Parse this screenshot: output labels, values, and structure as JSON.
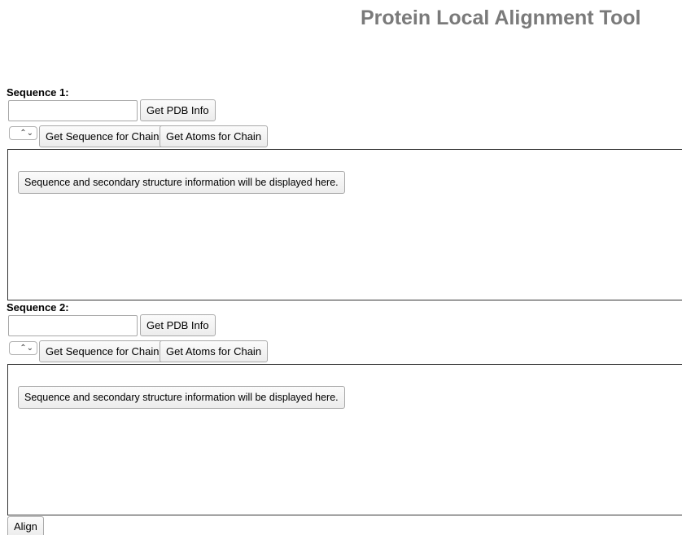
{
  "page": {
    "title": "Protein Local Alignment Tool"
  },
  "sequence1": {
    "label": "Sequence 1:",
    "pdb_input_value": "",
    "get_pdb_info_label": "Get PDB Info",
    "chain_select_value": "",
    "get_sequence_label": "Get Sequence for Chain",
    "get_atoms_label": "Get Atoms for Chain",
    "display_placeholder": "Sequence and secondary structure information will be displayed here."
  },
  "sequence2": {
    "label": "Sequence 2:",
    "pdb_input_value": "",
    "get_pdb_info_label": "Get PDB Info",
    "chain_select_value": "",
    "get_sequence_label": "Get Sequence for Chain",
    "get_atoms_label": "Get Atoms for Chain",
    "display_placeholder": "Sequence and secondary structure information will be displayed here."
  },
  "actions": {
    "align_label": "Align"
  }
}
